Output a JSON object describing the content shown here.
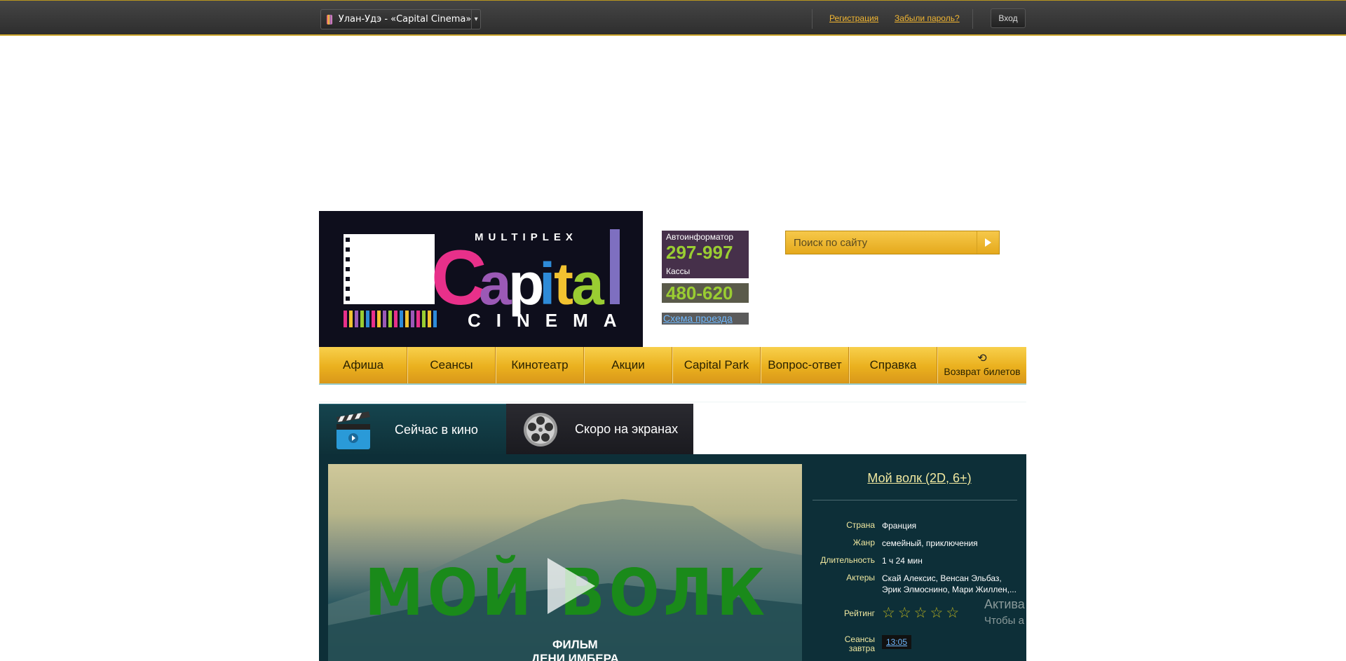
{
  "topbar": {
    "city_label": "Улан-Удэ - «Capital Cinema»",
    "register_link": "Регистрация",
    "forgot_link": "Забыли пароль?",
    "login_button": "Вход"
  },
  "header": {
    "logo": {
      "top_text": "MULTIPLEX",
      "main_text": "Capital",
      "bottom_text": "CINEMA"
    },
    "autoinfo_label": "Автоинформатор",
    "autoinfo_number": "297-997",
    "cashier_label": "Кассы",
    "cashier_number": "480-620",
    "map_link": "Схема проезда",
    "search_placeholder": "Поиск по сайту"
  },
  "nav": {
    "items": [
      "Афиша",
      "Сеансы",
      "Кинотеатр",
      "Акции",
      "Capital Park",
      "Вопрос-ответ",
      "Справка"
    ],
    "return_label": "Возврат билетов"
  },
  "tabs": {
    "now": "Сейчас в кино",
    "soon": "Скоро на экранах"
  },
  "movie": {
    "title": "Мой волк (2D, 6+)",
    "trailer_title": "МОЙ ВОЛК",
    "trailer_sub1": "ФИЛЬМ",
    "trailer_sub2": "ДЕНИ ИМБЕРА",
    "country_label": "Страна",
    "country": "Франция",
    "genre_label": "Жанр",
    "genre": "семейный, приключения",
    "duration_label": "Длительность",
    "duration": "1 ч 24 мин",
    "actors_label": "Актеры",
    "actors": "Скай Алексис, Венсан Эльбаз, Эрик Элмоснино, Мари Жиллен,...",
    "rating_label": "Рейтинг",
    "rating": 0,
    "rating_max": 5,
    "sessions_label_1": "Сеансы",
    "sessions_label_2": "завтра",
    "session_time": "13:05"
  },
  "overlay": {
    "activate_1": "Актива",
    "activate_2": "Чтобы а"
  }
}
